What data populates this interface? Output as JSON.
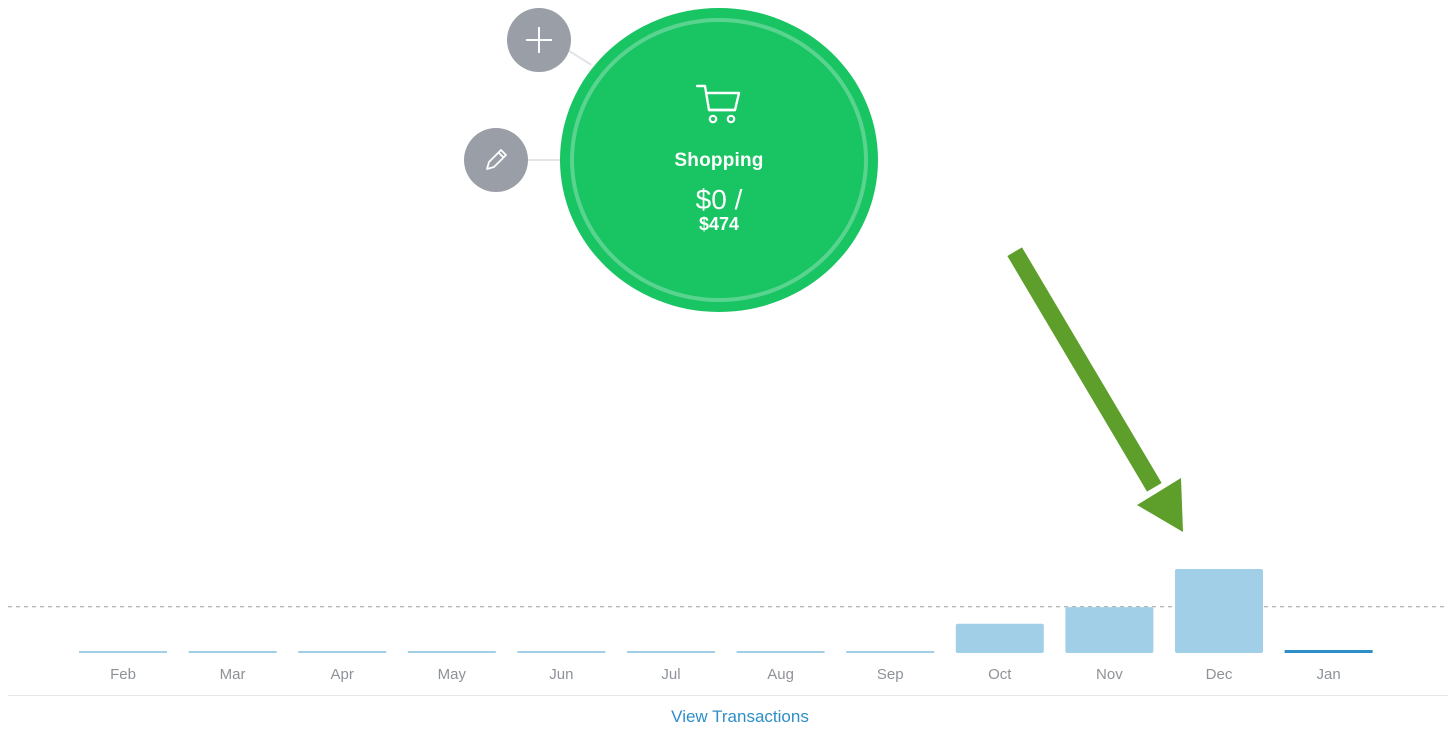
{
  "category": {
    "name": "Shopping",
    "spent": "$0 /",
    "budget": "$474",
    "icon": "shopping-cart-icon",
    "color": "#19c463"
  },
  "actions": {
    "add_icon": "plus-icon",
    "edit_icon": "pencil-icon"
  },
  "annotation": {
    "icon": "arrow-icon",
    "color": "#5e9e2a"
  },
  "chart_data": {
    "type": "bar",
    "categories": [
      "Feb",
      "Mar",
      "Apr",
      "May",
      "Jun",
      "Jul",
      "Aug",
      "Sep",
      "Oct",
      "Nov",
      "Dec",
      "Jan"
    ],
    "values": [
      0,
      0,
      0,
      0,
      0,
      0,
      0,
      0,
      300,
      470,
      860,
      0
    ],
    "reference_line": 474,
    "current_month": "Jan",
    "grid": false,
    "colors": {
      "bar": "#a1cfe8",
      "current": "#2e8ec7",
      "reference": "#9aa0a6"
    }
  },
  "footer": {
    "link_label": "View Transactions",
    "link_color": "#2e8ec7"
  }
}
